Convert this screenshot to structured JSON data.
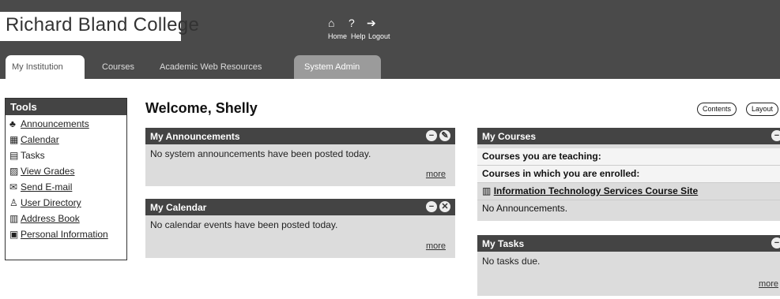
{
  "header": {
    "logo": "Richard Bland College",
    "top_links": [
      "Home",
      "Help",
      "Logout"
    ]
  },
  "tabs": [
    {
      "label": "My Institution"
    },
    {
      "label": "Courses"
    },
    {
      "label": "Academic Web Resources"
    },
    {
      "label": "System Admin"
    }
  ],
  "tools": {
    "title": "Tools",
    "items": [
      {
        "label": "Announcements"
      },
      {
        "label": "Calendar"
      },
      {
        "label": "Tasks"
      },
      {
        "label": "View Grades"
      },
      {
        "label": "Send E-mail"
      },
      {
        "label": "User Directory"
      },
      {
        "label": "Address Book"
      },
      {
        "label": "Personal Information"
      }
    ]
  },
  "welcome": "Welcome, Shelly",
  "buttons": {
    "content": "Contents",
    "layout": "Layout"
  },
  "announcements": {
    "title": "My Announcements",
    "text": "No system announcements have been posted today.",
    "more": "more"
  },
  "calendar": {
    "title": "My Calendar",
    "text": "No calendar events have been posted today.",
    "more": "more"
  },
  "courses": {
    "title": "My Courses",
    "teaching": "Courses you are teaching:",
    "enrolled": "Courses in which you are enrolled:",
    "course_link": "Information Technology Services Course Site",
    "note": "No Announcements."
  },
  "tasks": {
    "title": "My Tasks",
    "text": "No tasks due.",
    "more": "more"
  }
}
